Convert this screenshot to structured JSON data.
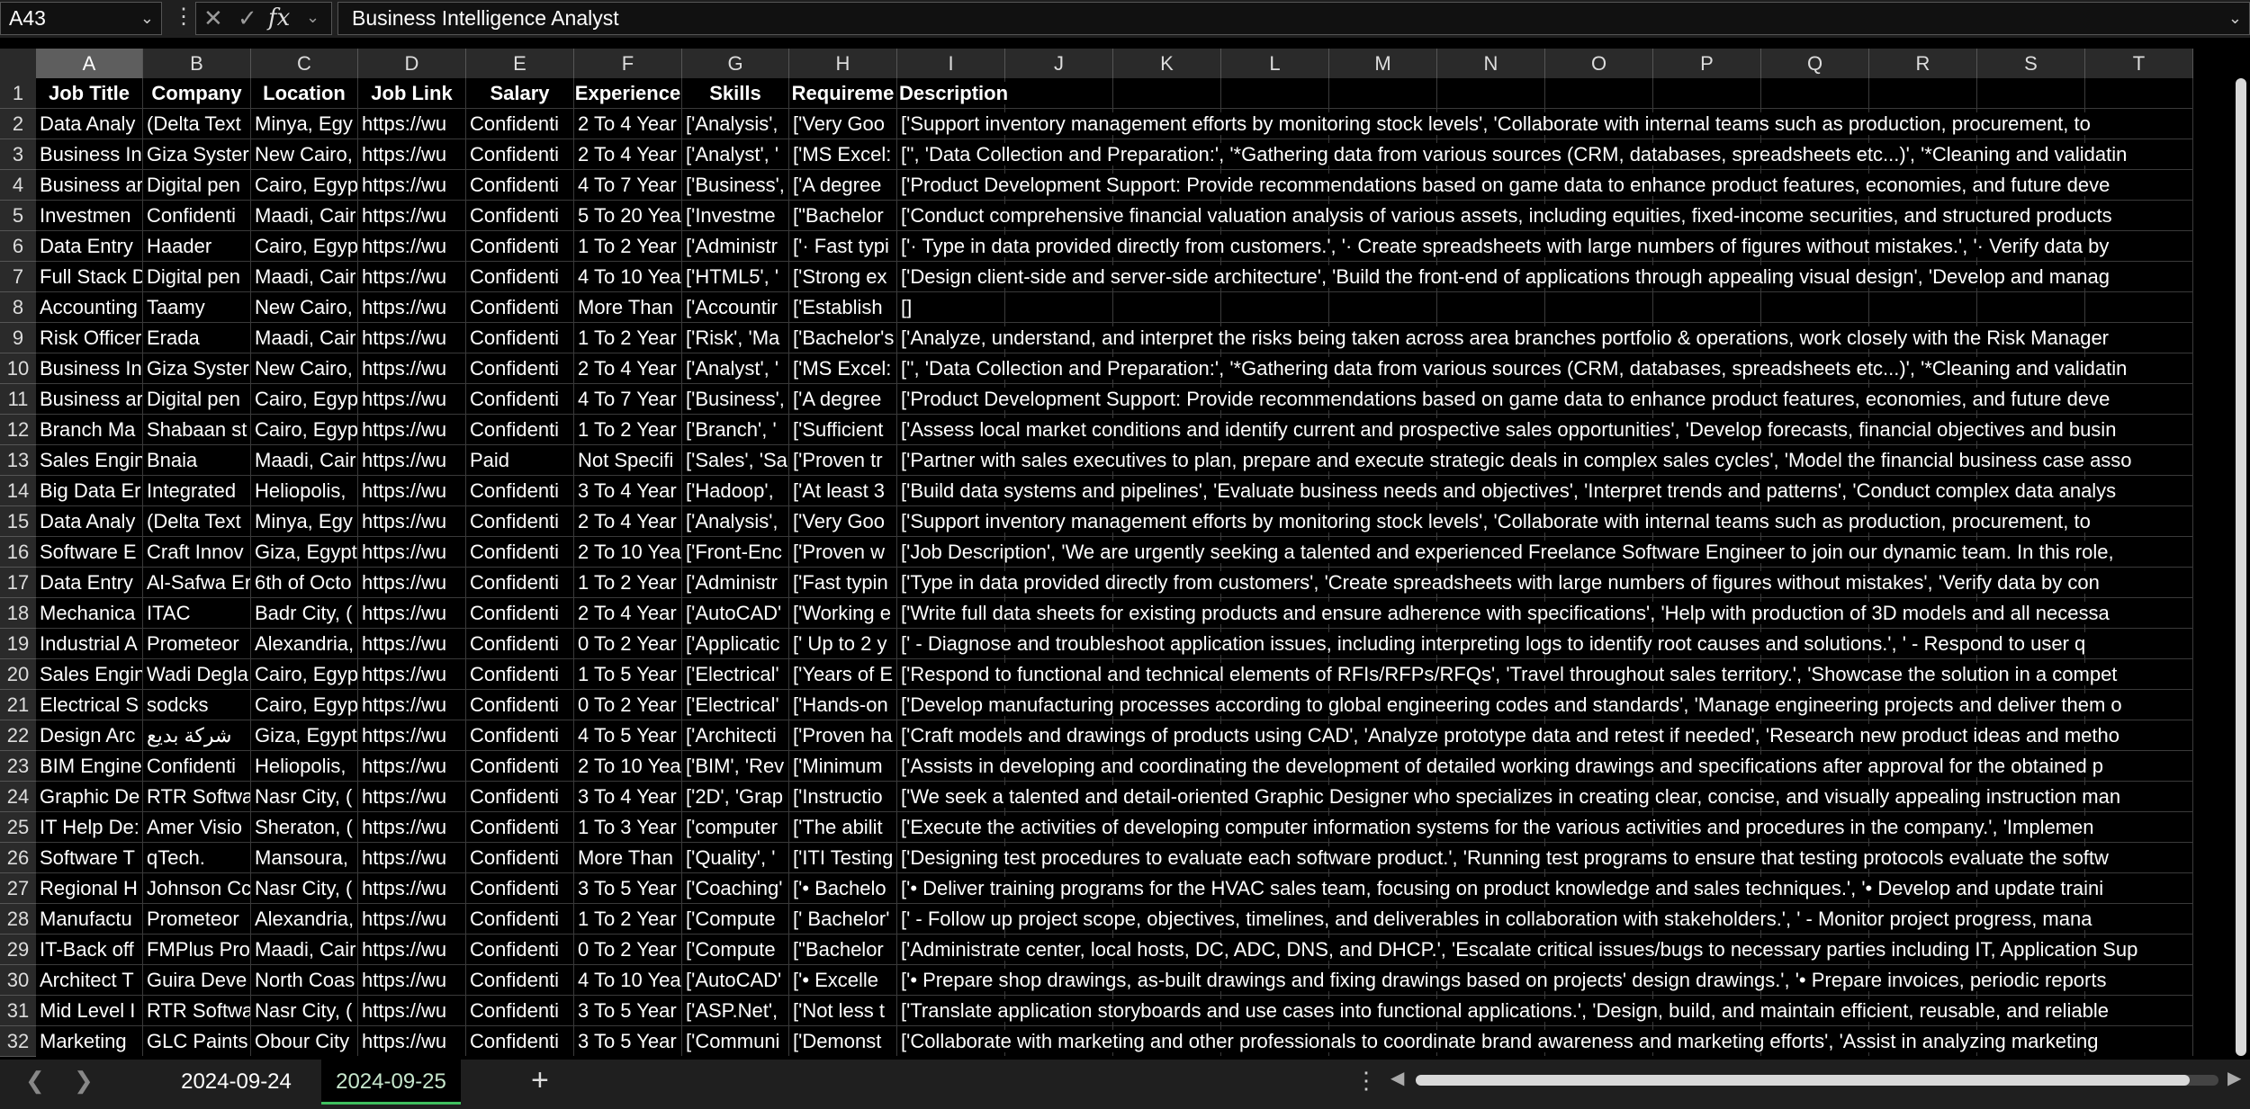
{
  "formula_bar": {
    "name_box": "A43",
    "formula_value": "Business Intelligence Analyst",
    "cancel_icon": "close-icon",
    "enter_icon": "check-icon",
    "function_icon": "fx-icon"
  },
  "grid": {
    "selected_column": "A",
    "column_letters": [
      "A",
      "B",
      "C",
      "D",
      "E",
      "F",
      "G",
      "H",
      "I",
      "J",
      "K",
      "L",
      "M",
      "N",
      "O",
      "P",
      "Q",
      "R",
      "S",
      "T"
    ],
    "row_numbers": [
      "1",
      "2",
      "3",
      "4",
      "5",
      "6",
      "7",
      "8",
      "9",
      "10",
      "11",
      "12",
      "13",
      "14",
      "15",
      "16",
      "17",
      "18",
      "19",
      "20",
      "21",
      "22",
      "23",
      "24",
      "25",
      "26",
      "27",
      "28",
      "29",
      "30",
      "31",
      "32"
    ],
    "header_row": [
      "Job Title",
      "Company",
      "Location",
      "Job Link",
      "Salary",
      "Experience",
      "Skills",
      "Requireme",
      "Description"
    ],
    "rows": [
      [
        "Data Analy",
        "(Delta Text",
        "Minya, Egy",
        "https://wu",
        "Confidenti",
        "2 To 4 Year",
        "['Analysis', ",
        "['Very Goo",
        "['Support inventory management efforts by monitoring stock levels', 'Collaborate with internal teams such as production, procurement, to"
      ],
      [
        "Business In",
        "Giza Syster",
        "New Cairo,",
        "https://wu",
        "Confidenti",
        "2 To 4 Year",
        "['Analyst', '",
        "['MS Excel:",
        "['', 'Data Collection and Preparation:', '*Gathering data from various sources (CRM, databases, spreadsheets etc...)', '*Cleaning and validatin"
      ],
      [
        "Business ar",
        "Digital pen",
        "Cairo, Egyp",
        "https://wu",
        "Confidenti",
        "4 To 7 Year",
        "['Business', ",
        "['A degree ",
        "['Product Development Support: Provide recommendations based on game data to enhance product features, economies, and future deve"
      ],
      [
        "Investmen",
        "Confidenti",
        "Maadi, Cair",
        "https://wu",
        "Confidenti",
        "5 To 20 Yea",
        "['Investme",
        "[\"Bachelor",
        "['Conduct comprehensive financial valuation analysis of various assets, including equities, fixed-income securities, and structured products"
      ],
      [
        "Data Entry",
        "Haader",
        "Cairo, Egyp",
        "https://wu",
        "Confidenti",
        "1 To 2 Year",
        "['Administr",
        "['· Fast typi",
        "['· Type in data provided directly from customers.', '· Create spreadsheets with large numbers of figures without mistakes.', '· Verify data by"
      ],
      [
        "Full Stack D",
        "Digital pen",
        "Maadi, Cair",
        "https://wu",
        "Confidenti",
        "4 To 10 Yea",
        "['HTML5', '",
        "['Strong ex",
        "['Design client-side and server-side architecture', 'Build the front-end of applications through appealing visual design', 'Develop and manag"
      ],
      [
        "Accounting",
        "Taamy",
        "New Cairo,",
        "https://wu",
        "Confidenti",
        "More Than",
        "['Accountir",
        "['Establish ",
        "[]"
      ],
      [
        "Risk Officer",
        "Erada",
        "Maadi, Cair",
        "https://wu",
        "Confidenti",
        "1 To 2 Year",
        "['Risk', 'Ma",
        "['Bachelor's",
        "['Analyze, understand, and interpret the risks being taken across area branches portfolio & operations, work closely with the Risk Manager"
      ],
      [
        "Business In",
        "Giza Syster",
        "New Cairo,",
        "https://wu",
        "Confidenti",
        "2 To 4 Year",
        "['Analyst', '",
        "['MS Excel:",
        "['', 'Data Collection and Preparation:', '*Gathering data from various sources (CRM, databases, spreadsheets etc...)', '*Cleaning and validatin"
      ],
      [
        "Business ar",
        "Digital pen",
        "Cairo, Egyp",
        "https://wu",
        "Confidenti",
        "4 To 7 Year",
        "['Business', ",
        "['A degree ",
        "['Product Development Support: Provide recommendations based on game data to enhance product features, economies, and future deve"
      ],
      [
        "Branch Ma",
        "Shabaan st",
        "Cairo, Egyp",
        "https://wu",
        "Confidenti",
        "1 To 2 Year",
        "['Branch', '",
        "['Sufficient",
        "['Assess local market conditions and identify current and prospective sales opportunities', 'Develop forecasts, financial objectives and busin"
      ],
      [
        "Sales Engin",
        "Bnaia",
        "Maadi, Cair",
        "https://wu",
        "Paid",
        "Not Specifi",
        "['Sales', 'Sa",
        "['Proven tr",
        "['Partner with sales executives to plan, prepare and execute strategic deals in complex sales cycles', 'Model the financial business case asso"
      ],
      [
        "Big Data Er",
        "Integrated",
        "Heliopolis,",
        "https://wu",
        "Confidenti",
        "3 To 4 Year",
        "['Hadoop', ",
        "['At least 3",
        "['Build data systems and pipelines', 'Evaluate business needs and objectives', 'Interpret trends and patterns', 'Conduct complex data analys"
      ],
      [
        "Data Analy",
        "(Delta Text",
        "Minya, Egy",
        "https://wu",
        "Confidenti",
        "2 To 4 Year",
        "['Analysis', ",
        "['Very Goo",
        "['Support inventory management efforts by monitoring stock levels', 'Collaborate with internal teams such as production, procurement, to"
      ],
      [
        "Software E",
        "Craft Innov",
        "Giza, Egypt",
        "https://wu",
        "Confidenti",
        "2 To 10 Yea",
        "['Front-Enc",
        "['Proven w",
        "['Job Description', 'We are urgently seeking a talented and experienced Freelance Software Engineer to join our dynamic team. In this role,"
      ],
      [
        "Data Entry",
        "Al-Safwa Er",
        "6th of Octo",
        "https://wu",
        "Confidenti",
        "1 To 2 Year",
        "['Administr",
        "['Fast typin",
        "['Type in data provided directly from customers', 'Create spreadsheets with large numbers of figures without mistakes', 'Verify data by con"
      ],
      [
        "Mechanica",
        "ITAC",
        "Badr City, (",
        "https://wu",
        "Confidenti",
        "2 To 4 Year",
        "['AutoCAD'",
        "['Working e",
        "['Write full data sheets for existing products and ensure adherence with specifications', 'Help with production of 3D models and all necessa"
      ],
      [
        "Industrial A",
        "Prometeor",
        "Alexandria,",
        "https://wu",
        "Confidenti",
        "0 To 2 Year",
        "['Applicatic",
        "['  Up to 2 y",
        "['   - Diagnose and troubleshoot application issues, including interpreting logs to identify root causes and solutions.', '   - Respond to user q"
      ],
      [
        "Sales Engin",
        "Wadi Degla",
        "Cairo, Egyp",
        "https://wu",
        "Confidenti",
        "1 To 5 Year",
        "['Electrical'",
        "['Years of E",
        "['Respond to functional and technical elements of RFIs/RFPs/RFQs', 'Travel throughout sales territory.', 'Showcase the solution in a compet"
      ],
      [
        "Electrical S",
        "sodcks",
        "Cairo, Egyp",
        "https://wu",
        "Confidenti",
        "0 To 2 Year",
        "['Electrical'",
        "['Hands-on",
        "['Develop manufacturing processes according to global engineering codes and standards', 'Manage engineering projects and deliver them o"
      ],
      [
        "Design Arc",
        "شركة بديع",
        "Giza, Egypt",
        "https://wu",
        "Confidenti",
        "4 To 5 Year",
        "['Architecti",
        "['Proven ha",
        "['Craft models and drawings of products using CAD', 'Analyze prototype data and retest if needed', 'Research new product ideas and metho"
      ],
      [
        "BIM Engine",
        "Confidenti",
        "Heliopolis,",
        "https://wu",
        "Confidenti",
        "2 To 10 Yea",
        "['BIM', 'Rev",
        "['Minimum",
        "['Assists in developing and coordinating the development of detailed working drawings and specifications after approval for the obtained p"
      ],
      [
        "Graphic De",
        "RTR Softwa",
        "Nasr City, (",
        "https://wu",
        "Confidenti",
        "3 To 4 Year",
        "['2D', 'Grap",
        "['Instructio",
        "['We seek a talented and detail-oriented Graphic Designer who specializes in creating clear, concise, and visually appealing instruction man"
      ],
      [
        "IT Help De:",
        "Amer Visio",
        "Sheraton, (",
        "https://wu",
        "Confidenti",
        "1 To 3 Year",
        "['computer",
        "['The abilit",
        "['Execute the activities of developing computer information systems for the various activities and procedures in the company.', 'Implemen"
      ],
      [
        "Software T",
        "qTech.",
        "Mansoura,",
        "https://wu",
        "Confidenti",
        "More Than",
        "['Quality', '",
        "['ITI Testing",
        "['Designing test procedures to evaluate each software product.', 'Running test programs to ensure that testing protocols evaluate the softw"
      ],
      [
        "Regional H",
        "Johnson Cc",
        "Nasr City, (",
        "https://wu",
        "Confidenti",
        "3 To 5 Year",
        "['Coaching'",
        "['• Bachelo",
        "['• Deliver training programs for the HVAC sales team, focusing on product knowledge and sales techniques.', '• Develop and update traini"
      ],
      [
        "Manufactu",
        "Prometeor",
        "Alexandria,",
        "https://wu",
        "Confidenti",
        "1 To 2 Year",
        "['Compute",
        "[' Bachelor'",
        "['  - Follow up project scope, objectives, timelines, and deliverables in collaboration with stakeholders.', '  - Monitor project progress, mana"
      ],
      [
        "IT-Back off",
        "FMPlus Pro",
        "Maadi, Cair",
        "https://wu",
        "Confidenti",
        "0 To 2 Year",
        "['Compute",
        "[\"Bachelor",
        "['Administrate center, local hosts, DC, ADC, DNS, and DHCP.', 'Escalate critical issues/bugs to necessary parties including IT, Application Sup"
      ],
      [
        "Architect T",
        "Guira Deve",
        "North Coas",
        "https://wu",
        "Confidenti",
        "4 To 10 Yea",
        "['AutoCAD'",
        "['•  Excelle",
        "['•  Prepare shop drawings, as-built drawings and fixing drawings based on projects' design drawings.', '•  Prepare invoices, periodic reports"
      ],
      [
        "Mid Level I",
        "RTR Softwa",
        "Nasr City, (",
        "https://wu",
        "Confidenti",
        "3 To 5 Year",
        "['ASP.Net', ",
        "['Not less t",
        "['Translate application storyboards and use cases into functional applications.', 'Design, build, and maintain efficient, reusable, and reliable"
      ],
      [
        "Marketing",
        "GLC Paints",
        "Obour City",
        "https://wu",
        "Confidenti",
        "3 To 5 Year",
        "['Communi",
        "['Demonst",
        "['Collaborate with marketing and other professionals to coordinate brand awareness and marketing efforts', 'Assist in analyzing marketing"
      ]
    ]
  },
  "sheet_tabs": {
    "tabs": [
      "2024-09-24",
      "2024-09-25"
    ],
    "active": "2024-09-25",
    "add_icon": "plus-icon"
  },
  "colors": {
    "background": "#000000",
    "header_bg": "#2a2a2a",
    "selected_header_bg": "#5e5e5e",
    "active_tab_underline": "#3fbf5e"
  }
}
